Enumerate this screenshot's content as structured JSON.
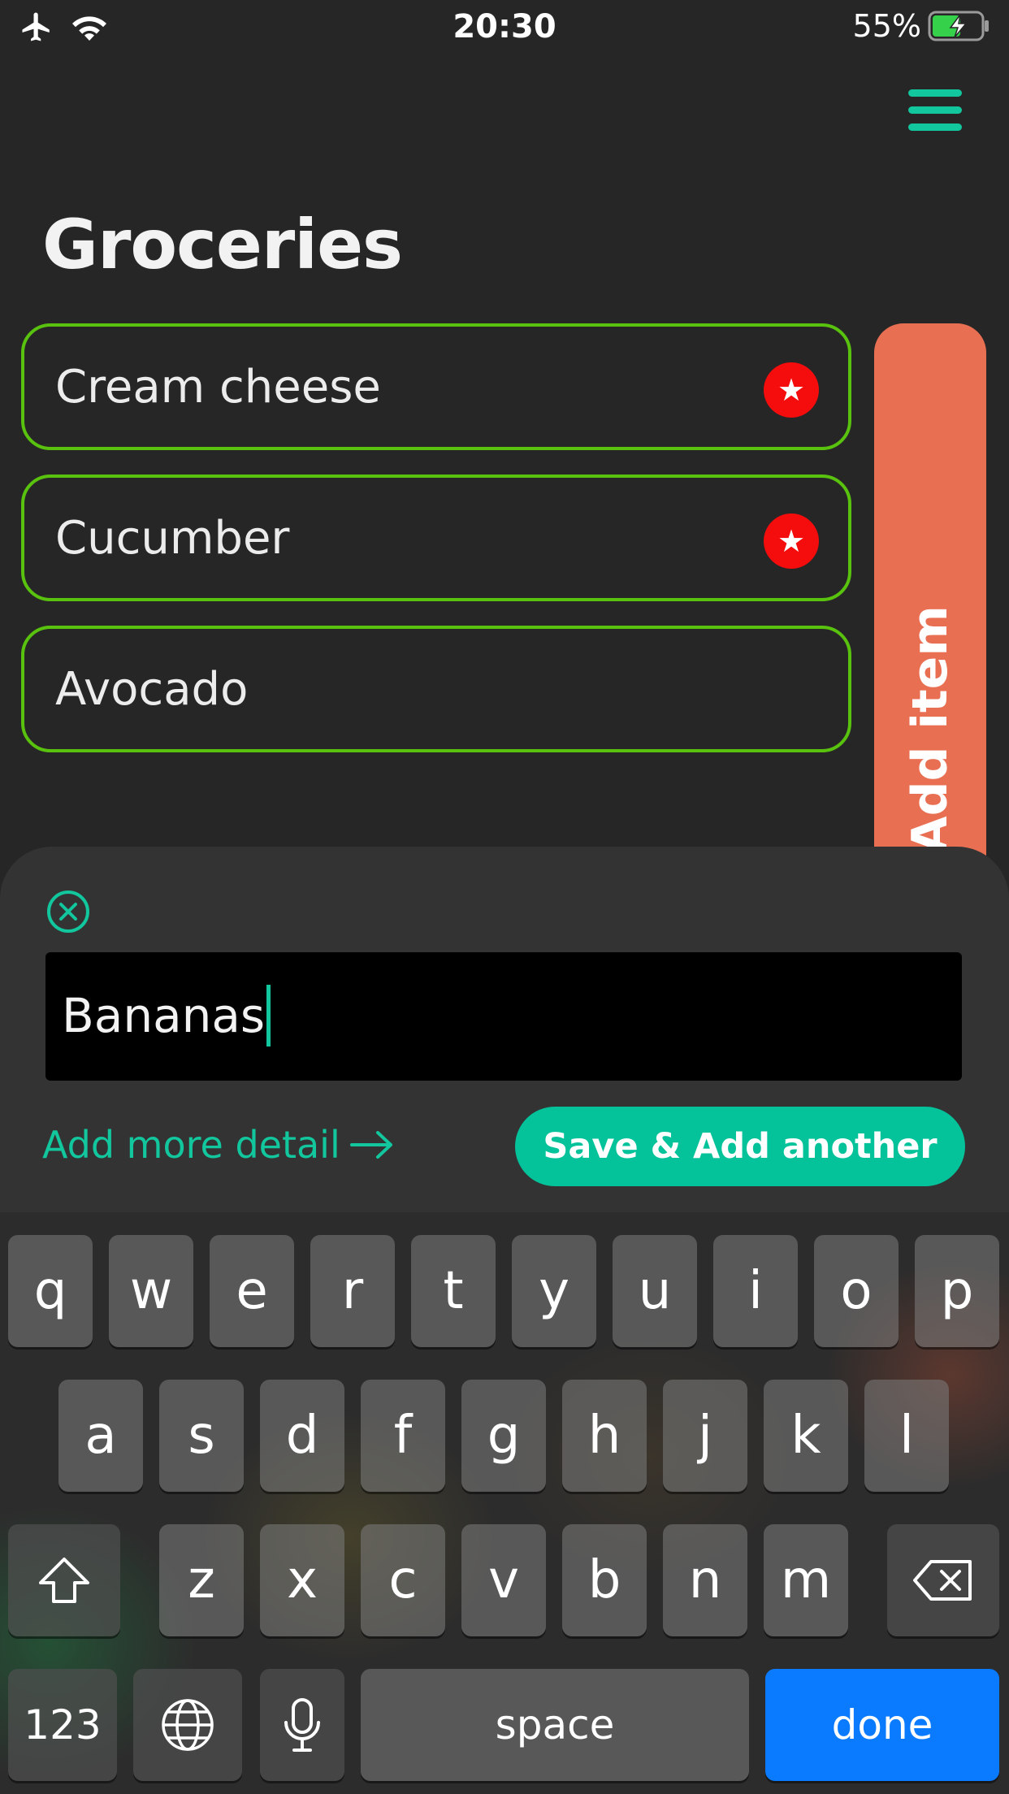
{
  "status_bar": {
    "time": "20:30",
    "battery_percent": "55%",
    "icons": [
      "airplane-icon",
      "wifi-icon",
      "battery-charging-icon"
    ]
  },
  "header": {
    "title": "Groceries",
    "menu_icon": "hamburger-icon"
  },
  "list": {
    "items": [
      {
        "label": "Cream cheese",
        "starred": true
      },
      {
        "label": "Cucumber",
        "starred": true
      },
      {
        "label": "Avocado",
        "starred": false
      }
    ],
    "star_glyph": "★"
  },
  "side_tab": {
    "label": "Add item"
  },
  "sheet": {
    "input_value": "Bananas",
    "detail_link": "Add more detail",
    "save_label": "Save & Add another"
  },
  "keyboard": {
    "row1": [
      "q",
      "w",
      "e",
      "r",
      "t",
      "y",
      "u",
      "i",
      "o",
      "p"
    ],
    "row2": [
      "a",
      "s",
      "d",
      "f",
      "g",
      "h",
      "j",
      "k",
      "l"
    ],
    "row3": [
      "z",
      "x",
      "c",
      "v",
      "b",
      "n",
      "m"
    ],
    "numbers_label": "123",
    "space_label": "space",
    "done_label": "done"
  },
  "colors": {
    "accent": "#12c69d",
    "item_border": "#59c20f",
    "star": "#f50c0c",
    "side_tab": "#e96f53",
    "done_key": "#0a7bff"
  }
}
